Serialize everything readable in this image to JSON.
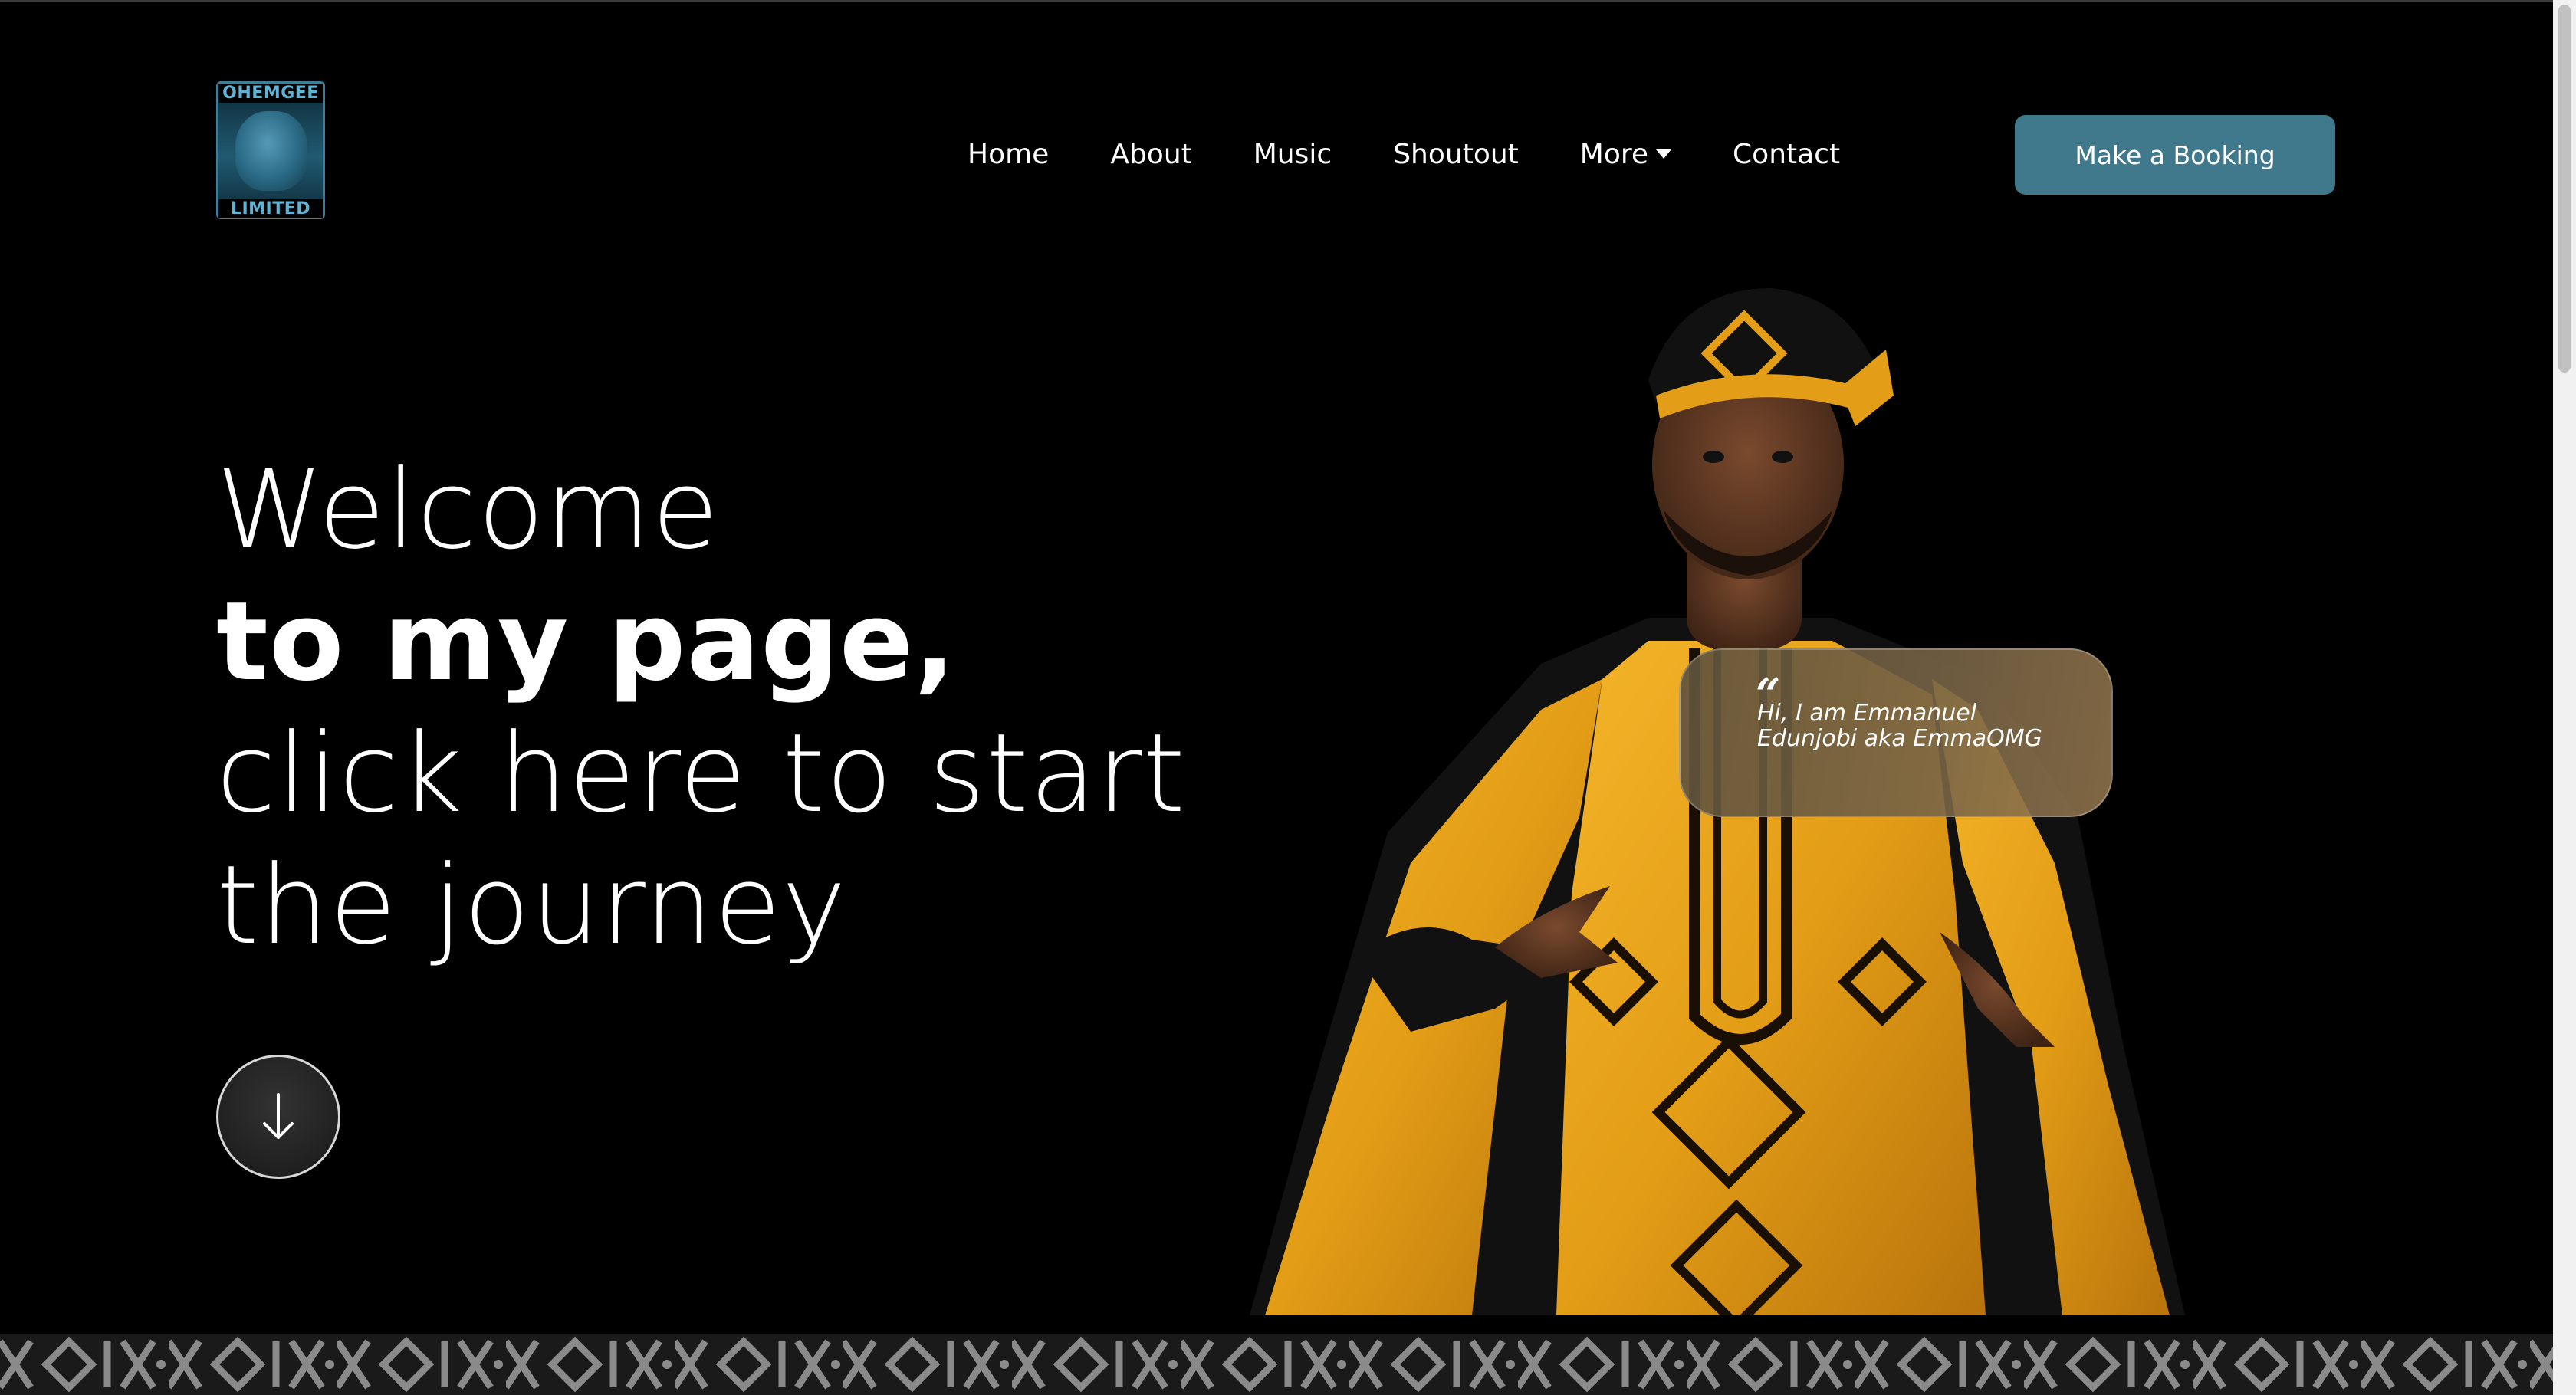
{
  "logo": {
    "top_text": "OHEMGEE",
    "bottom_text": "LIMITED"
  },
  "nav": {
    "items": [
      {
        "label": "Home"
      },
      {
        "label": "About"
      },
      {
        "label": "Music"
      },
      {
        "label": "Shoutout"
      },
      {
        "label": "More",
        "has_dropdown": true
      },
      {
        "label": "Contact"
      }
    ],
    "caret_icon": "caret-down-icon"
  },
  "booking_button": {
    "label": "Make a Booking",
    "color": "#40798c"
  },
  "hero": {
    "line1": "Welcome",
    "line2": "to my page,",
    "line3": "click here to start",
    "line4": "the journey",
    "scroll_icon": "arrow-down-icon"
  },
  "bubble": {
    "quote_mark": "“",
    "text": "Hi, I am Emmanuel Edunjobi aka EmmaOMG"
  },
  "colors": {
    "background": "#000000",
    "accent": "#40798c",
    "robe_gold": "#e8a21c"
  }
}
